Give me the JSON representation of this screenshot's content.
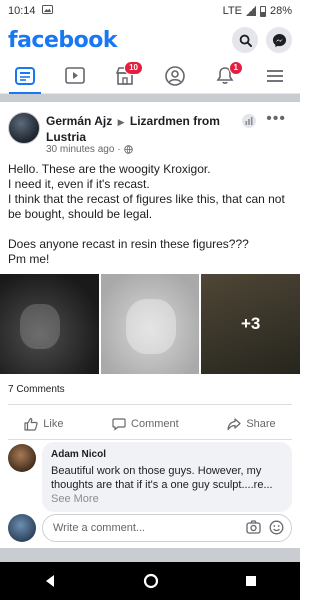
{
  "status_bar": {
    "time": "10:14",
    "network": "LTE",
    "battery": "28%"
  },
  "header": {
    "logo": "facebook"
  },
  "tabs": [
    {
      "name": "news-feed",
      "badge": ""
    },
    {
      "name": "watch",
      "badge": ""
    },
    {
      "name": "marketplace",
      "badge": "10"
    },
    {
      "name": "profile",
      "badge": ""
    },
    {
      "name": "notifications",
      "badge": "1"
    },
    {
      "name": "menu",
      "badge": ""
    }
  ],
  "post": {
    "author": "Germán Ajz",
    "group": "Lizardmen from Lustria",
    "time": "30 minutes ago",
    "text": "Hello. These are the woogity Kroxigor.\nI need it, even if it's recast.\nI think that the recast of figures like this, that can not be bought, should be legal.\n\nDoes anyone recast in resin these figures???\nPm me!",
    "more_photos": "+3",
    "comment_count": "7 Comments",
    "actions": {
      "like": "Like",
      "comment": "Comment",
      "share": "Share"
    }
  },
  "comment": {
    "name": "Adam Nicol",
    "text": "Beautiful work on those guys. However, my thoughts are that if it's a one guy sculpt....re...",
    "see_more": "See More"
  },
  "composer": {
    "placeholder": "Write a comment..."
  },
  "colors": {
    "brand": "#1877f2",
    "badge": "#e41e3f",
    "muted": "#65676b"
  }
}
